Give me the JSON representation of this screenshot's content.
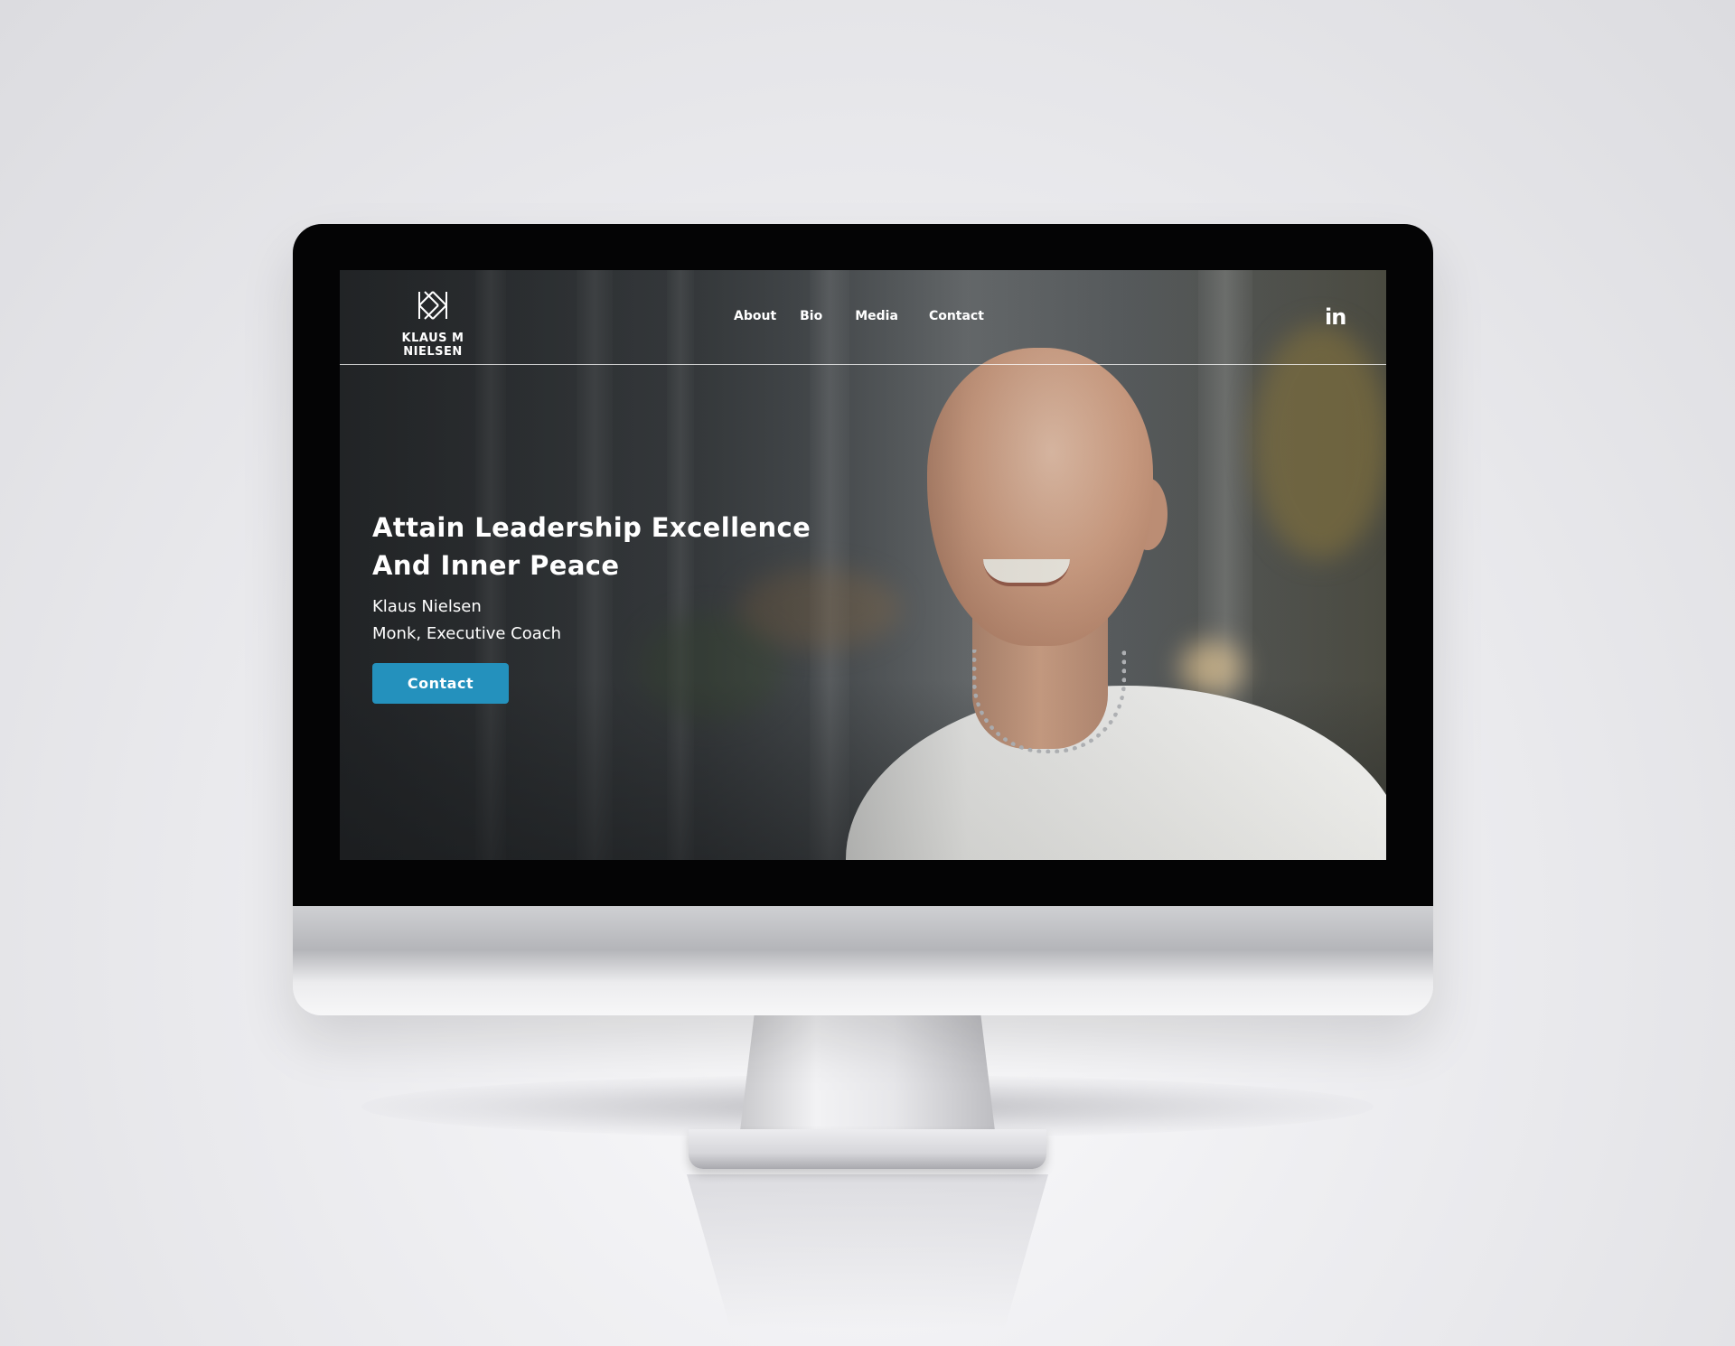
{
  "site": {
    "logo_text": "KLAUS M NIELSEN"
  },
  "nav": {
    "items": [
      {
        "label": "About"
      },
      {
        "label": "Bio"
      },
      {
        "label": "Media"
      },
      {
        "label": "Contact"
      }
    ]
  },
  "social": {
    "linkedin_label": "in"
  },
  "hero": {
    "title_line1": "Attain Leadership Excellence",
    "title_line2": "And Inner Peace",
    "name": "Klaus Nielsen",
    "role": "Monk, Executive Coach",
    "button_label": "Contact"
  },
  "colors": {
    "accent": "#2491bd",
    "text": "#ffffff",
    "bezel": "#040405"
  },
  "icons": {
    "logo": "km-monogram-icon",
    "social": "linkedin-icon"
  }
}
